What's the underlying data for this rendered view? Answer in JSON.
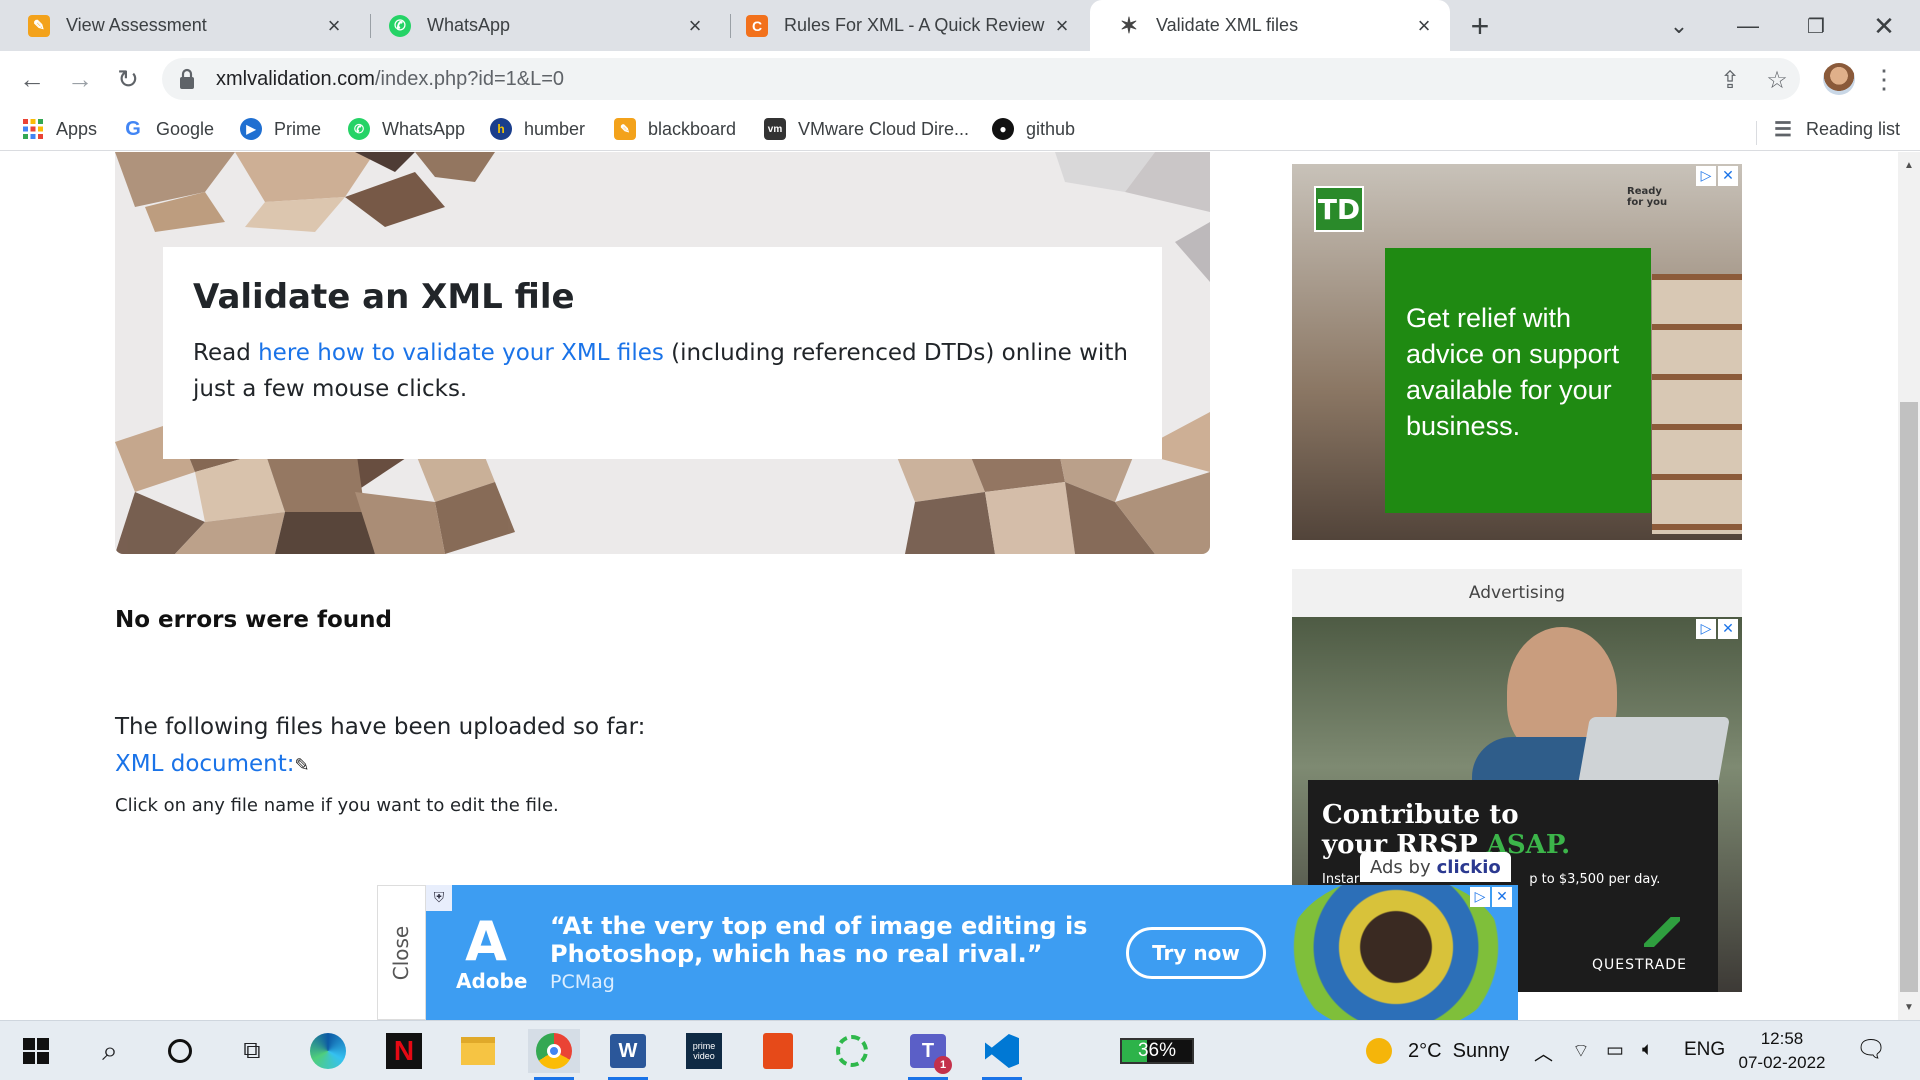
{
  "tabs": [
    {
      "title": "View Assessment",
      "favicon": "pencil-icon",
      "color": "#f3a21b"
    },
    {
      "title": "WhatsApp",
      "favicon": "whatsapp-icon",
      "color": "#25d366"
    },
    {
      "title": "Rules For XML - A Quick Review |",
      "favicon": "c-icon",
      "color": "#f2711c"
    },
    {
      "title": "Validate XML files",
      "favicon": "sparkle-icon",
      "color": "#444444",
      "active": true
    }
  ],
  "address_bar": {
    "host": "xmlvalidation.com",
    "path": "/index.php?id=1&L=0"
  },
  "bookmarks": [
    {
      "label": "Apps",
      "icon": "apps-grid-icon"
    },
    {
      "label": "Google",
      "icon": "google-icon"
    },
    {
      "label": "Prime",
      "icon": "prime-icon"
    },
    {
      "label": "WhatsApp",
      "icon": "whatsapp-icon"
    },
    {
      "label": "humber",
      "icon": "humber-icon"
    },
    {
      "label": "blackboard",
      "icon": "pencil-icon"
    },
    {
      "label": "VMware Cloud Dire...",
      "icon": "vm-icon"
    },
    {
      "label": "github",
      "icon": "github-icon"
    }
  ],
  "reading_list": "Reading list",
  "hero": {
    "title": "Validate an XML file",
    "text_before": "Read ",
    "link": "here how to validate your XML files",
    "text_after": " (including referenced DTDs) online with just a few mouse clicks."
  },
  "status": "No errors were found",
  "uploaded_heading": "The following files have been uploaded so far:",
  "xml_link": "XML document:",
  "edit_hint": "Click on any file name if you want to edit the file.",
  "ad_td": {
    "logo": "TD",
    "ready": "Ready\nfor you",
    "message": "Get relief with advice on support available for your business."
  },
  "advertising_label": "Advertising",
  "ad_questrade": {
    "headline_1": "Contribute to",
    "headline_2": "your RRSP ",
    "headline_asap": "ASAP.",
    "sub_left": "Instar",
    "sub_right": "p to $3,500 per day.",
    "brand": "QUESTRADE"
  },
  "ads_by": {
    "prefix": "Ads by",
    "brand": "clickio"
  },
  "ad_adobe": {
    "close": "Close",
    "brand": "Adobe",
    "quote": "“At the very top end of image editing is Photoshop, which has no real rival.”",
    "source": "PCMag",
    "cta": "Try now"
  },
  "taskbar": {
    "battery": "36%",
    "weather": "2°C  Sunny",
    "lang": "ENG",
    "time": "12:58",
    "date": "07-02-2022"
  }
}
